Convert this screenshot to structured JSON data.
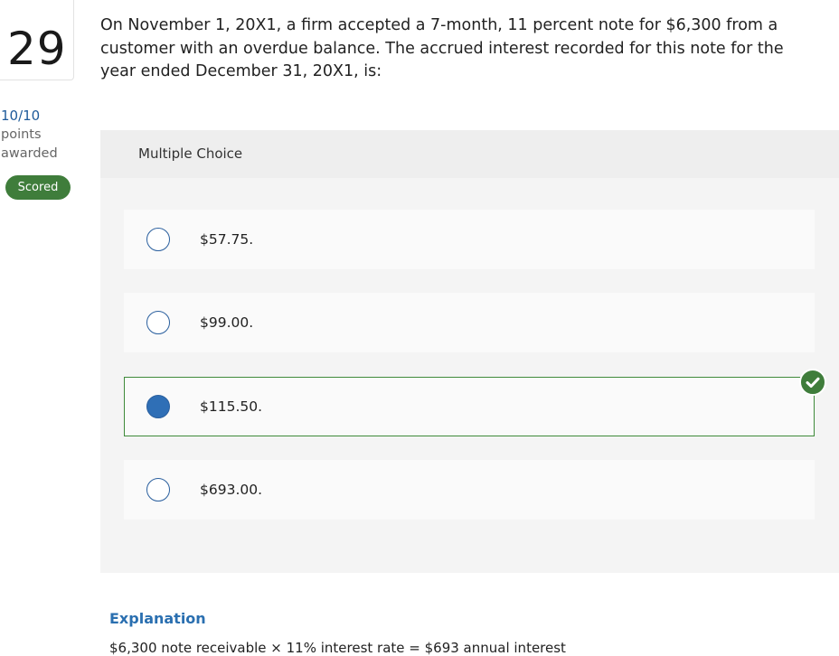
{
  "question": {
    "number": "29",
    "text": "On November 1, 20X1, a firm accepted a 7-month, 11 percent note for $6,300 from a customer with an overdue balance. The accrued interest recorded for this note for the year ended December 31, 20X1, is:"
  },
  "score": {
    "value": "10/10",
    "line1": "points",
    "line2": "awarded",
    "badge": "Scored"
  },
  "multiple_choice": {
    "label": "Multiple Choice",
    "choices": [
      {
        "text": "$57.75."
      },
      {
        "text": "$99.00."
      },
      {
        "text": "$115.50."
      },
      {
        "text": "$693.00."
      }
    ],
    "selected_index": 2,
    "correct_index": 2
  },
  "explanation": {
    "title": "Explanation",
    "line1": "$6,300 note receivable × 11% interest rate = $693 annual interest"
  },
  "colors": {
    "accent_blue": "#2f6fb6",
    "correct_green": "#3f7d3b"
  }
}
